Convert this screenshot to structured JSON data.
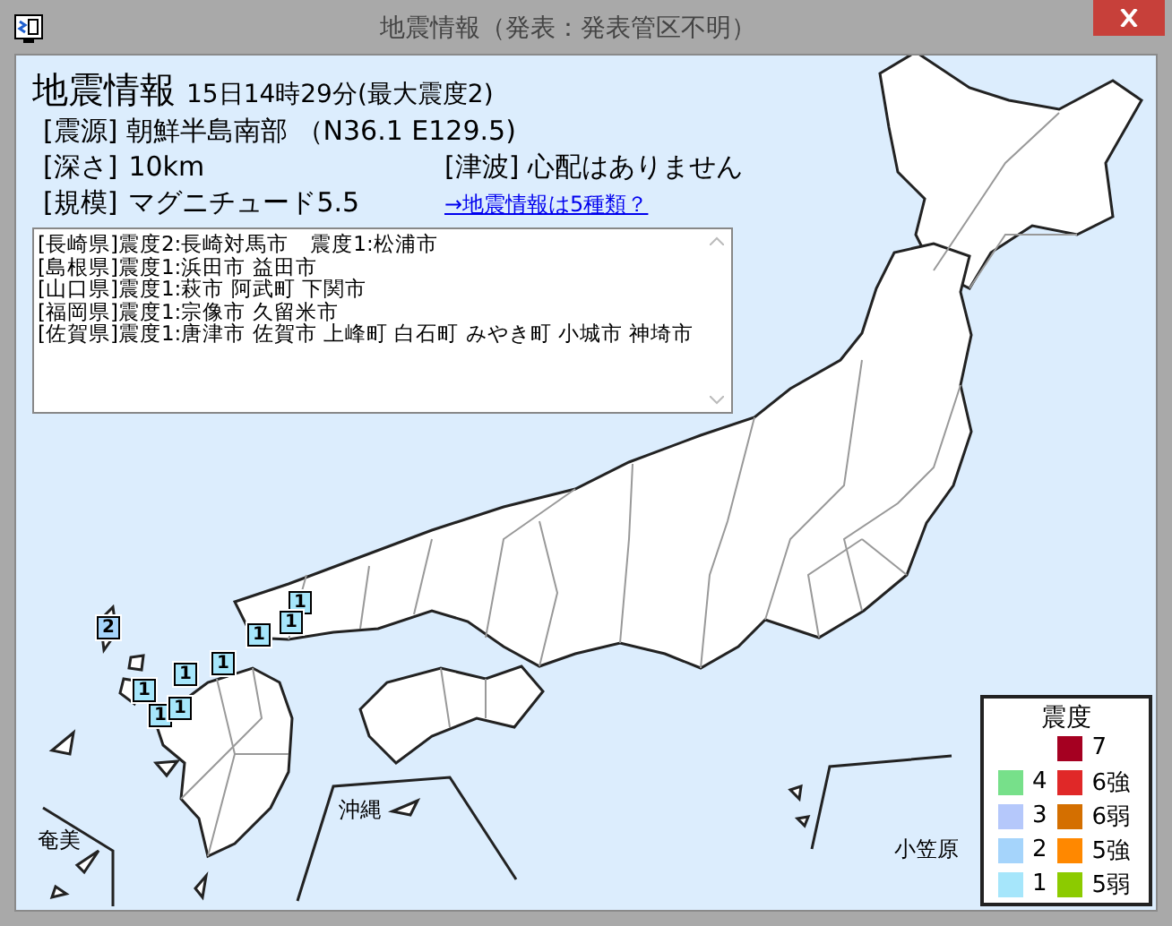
{
  "window": {
    "title": "地震情報（発表：発表管区不明）"
  },
  "header": {
    "title": "地震情報",
    "time": "15日14時29分(最大震度2)"
  },
  "epicenter": {
    "label": "[震源]",
    "value": "朝鮮半島南部 （N36.1 E129.5)"
  },
  "depth": {
    "label": "[深さ]",
    "value": "10km"
  },
  "tsunami": {
    "label": "[津波]",
    "value": "心配はありません"
  },
  "magnitude": {
    "label": "[規模]",
    "value": "マグニチュード5.5"
  },
  "link": "→地震情報は5種類？",
  "observations": [
    "[長崎県]震度2:長崎対馬市　震度1:松浦市",
    "[島根県]震度1:浜田市 益田市",
    "[山口県]震度1:萩市 阿武町 下関市",
    "[福岡県]震度1:宗像市 久留米市",
    "[佐賀県]震度1:唐津市 佐賀市 上峰町 白石町 みやき町 小城市 神埼市"
  ],
  "map": {
    "markers": [
      {
        "text": "2",
        "color": "#a5d4fb"
      },
      {
        "text": "1",
        "color": "#a6e6fb"
      },
      {
        "text": "1",
        "color": "#a6e6fb"
      },
      {
        "text": "1",
        "color": "#a6e6fb"
      },
      {
        "text": "1",
        "color": "#a6e6fb"
      },
      {
        "text": "1",
        "color": "#a6e6fb"
      },
      {
        "text": "1",
        "color": "#a6e6fb"
      },
      {
        "text": "1",
        "color": "#a6e6fb"
      },
      {
        "text": "1",
        "color": "#a6e6fb"
      }
    ],
    "region_labels": [
      "奄美",
      "沖縄",
      "小笠原"
    ]
  },
  "legend": {
    "title": "震度",
    "left": [
      {
        "label": "4",
        "color": "#77e08a"
      },
      {
        "label": "3",
        "color": "#b5c8fb"
      },
      {
        "label": "2",
        "color": "#a5d4fb"
      },
      {
        "label": "1",
        "color": "#a6e6fb"
      }
    ],
    "right": [
      {
        "label": "7",
        "color": "#a50021"
      },
      {
        "label": "6強",
        "color": "#e02828"
      },
      {
        "label": "6弱",
        "color": "#d46f00"
      },
      {
        "label": "5強",
        "color": "#ff8800"
      },
      {
        "label": "5弱",
        "color": "#8ccb00"
      }
    ]
  }
}
